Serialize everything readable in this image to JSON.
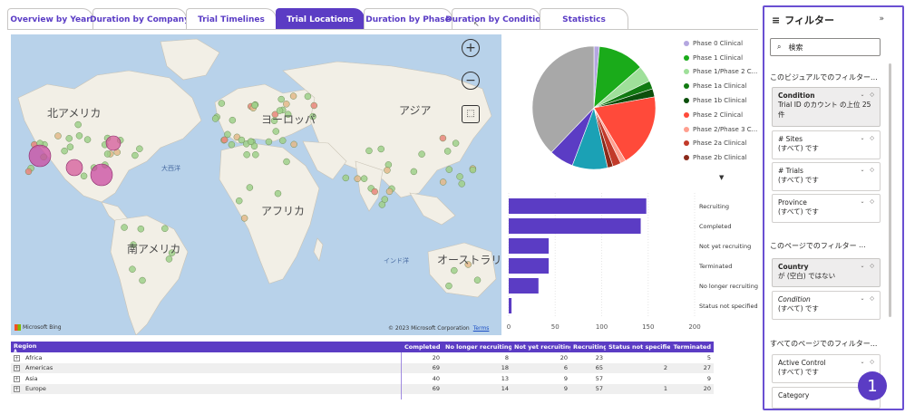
{
  "tabs": [
    {
      "label": "Overview by Year",
      "active": false
    },
    {
      "label": "Duration by Company",
      "active": false
    },
    {
      "label": "Trial Timelines",
      "active": false
    },
    {
      "label": "Trial Locations",
      "active": true
    },
    {
      "label": "Duration by Phase",
      "active": false
    },
    {
      "label": "Duration by Condition",
      "active": false
    },
    {
      "label": "Statistics",
      "active": false
    }
  ],
  "map": {
    "labels": {
      "north_america": "北アメリカ",
      "europe": "ヨーロッパ",
      "asia": "アジア",
      "atlantic": "大西洋",
      "africa": "アフリカ",
      "south_america": "南アメリカ",
      "indian_ocean": "インド洋",
      "australia": "オーストラリ"
    },
    "zoom_in": "+",
    "zoom_out": "−",
    "select_icon": "⬚",
    "bing": "Microsoft Bing",
    "copyright": "© 2023 Microsoft Corporation",
    "terms": "Terms"
  },
  "pie_legend": [
    {
      "label": "Phase 0 Clinical",
      "color": "#b4a7e0"
    },
    {
      "label": "Phase 1 Clinical",
      "color": "#1aab1a"
    },
    {
      "label": "Phase 1/Phase 2 C...",
      "color": "#9fe09a"
    },
    {
      "label": "Phase 1a Clinical",
      "color": "#117a11"
    },
    {
      "label": "Phase 1b Clinical",
      "color": "#0c4f0c"
    },
    {
      "label": "Phase 2 Clinical",
      "color": "#ff4a3a"
    },
    {
      "label": "Phase 2/Phase 3 C...",
      "color": "#ff9f8f"
    },
    {
      "label": "Phase 2a Clinical",
      "color": "#c23a2a"
    },
    {
      "label": "Phase 2b Clinical",
      "color": "#8b2a1a"
    }
  ],
  "legend_more": "▼",
  "status_chart": {
    "type": "bar",
    "categories": [
      "Recruiting",
      "Completed",
      "Not yet recruiting",
      "Terminated",
      "No longer recruiting",
      "Status not specified"
    ],
    "values": [
      148,
      142,
      43,
      43,
      32,
      3
    ],
    "xlim": [
      0,
      200
    ],
    "xticks": [
      "0",
      "50",
      "100",
      "150",
      "200"
    ],
    "color": "#5b3cc4"
  },
  "phase_chart": {
    "type": "pie",
    "slices": [
      {
        "label": "Phase 0 Clinical",
        "value": 2,
        "color": "#b4a7e0"
      },
      {
        "label": "Phase 1 Clinical",
        "value": 17,
        "color": "#1aab1a"
      },
      {
        "label": "Phase 1/Phase 2 C...",
        "value": 6,
        "color": "#9fe09a"
      },
      {
        "label": "Phase 1a Clinical",
        "value": 3,
        "color": "#117a11"
      },
      {
        "label": "Phase 1b Clinical",
        "value": 3,
        "color": "#0c4f0c"
      },
      {
        "label": "Phase 2 Clinical",
        "value": 27,
        "color": "#ff4a3a"
      },
      {
        "label": "Phase 2/Phase 3 C...",
        "value": 2,
        "color": "#ff9f8f"
      },
      {
        "label": "Phase 2a Clinical",
        "value": 3,
        "color": "#c23a2a"
      },
      {
        "label": "Phase 2b Clinical",
        "value": 2,
        "color": "#8b2a1a"
      },
      {
        "label": "",
        "value": 13,
        "color": "#1ba1b5"
      },
      {
        "label": "",
        "value": 9,
        "color": "#5b3cc4"
      },
      {
        "label": "",
        "value": 53,
        "color": "#a8a8a8"
      }
    ]
  },
  "region_table": {
    "headers": [
      "Region",
      "Completed",
      "No longer recruiting",
      "Not yet recruiting",
      "Recruiting",
      "Status not specified",
      "Terminated"
    ],
    "rows": [
      [
        "Africa",
        "20",
        "8",
        "20",
        "23",
        "",
        "5"
      ],
      [
        "Americas",
        "69",
        "18",
        "6",
        "65",
        "2",
        "27"
      ],
      [
        "Asia",
        "40",
        "13",
        "9",
        "57",
        "",
        "9"
      ],
      [
        "Europe",
        "69",
        "14",
        "9",
        "57",
        "1",
        "20"
      ]
    ]
  },
  "filter_pane": {
    "title": "フィルター",
    "collapse": "»",
    "search_placeholder": "検索",
    "visual_section": "このビジュアルでのフィルター...",
    "page_section": "このページでのフィルター",
    "all_pages_section": "すべてのページでのフィルター...",
    "more": "...",
    "visual_cards": [
      {
        "title": "Condition",
        "value": "Trial ID のカウント の上位 25 件"
      },
      {
        "title": "# Sites",
        "value": "(すべて) です"
      },
      {
        "title": "# Trials",
        "value": "(すべて) です"
      },
      {
        "title": "Province",
        "value": "(すべて) です"
      }
    ],
    "page_cards": [
      {
        "title": "Country",
        "value": "が (空白) ではない"
      },
      {
        "title": "Condition",
        "value": "(すべて) です"
      }
    ],
    "all_cards": [
      {
        "title": "Active Control",
        "value": "(すべて) です"
      },
      {
        "title": "Category",
        "value": ""
      }
    ],
    "card_controls": "⌄ ◇"
  },
  "badge": "1",
  "colors": {
    "accent": "#5b3cc4"
  }
}
